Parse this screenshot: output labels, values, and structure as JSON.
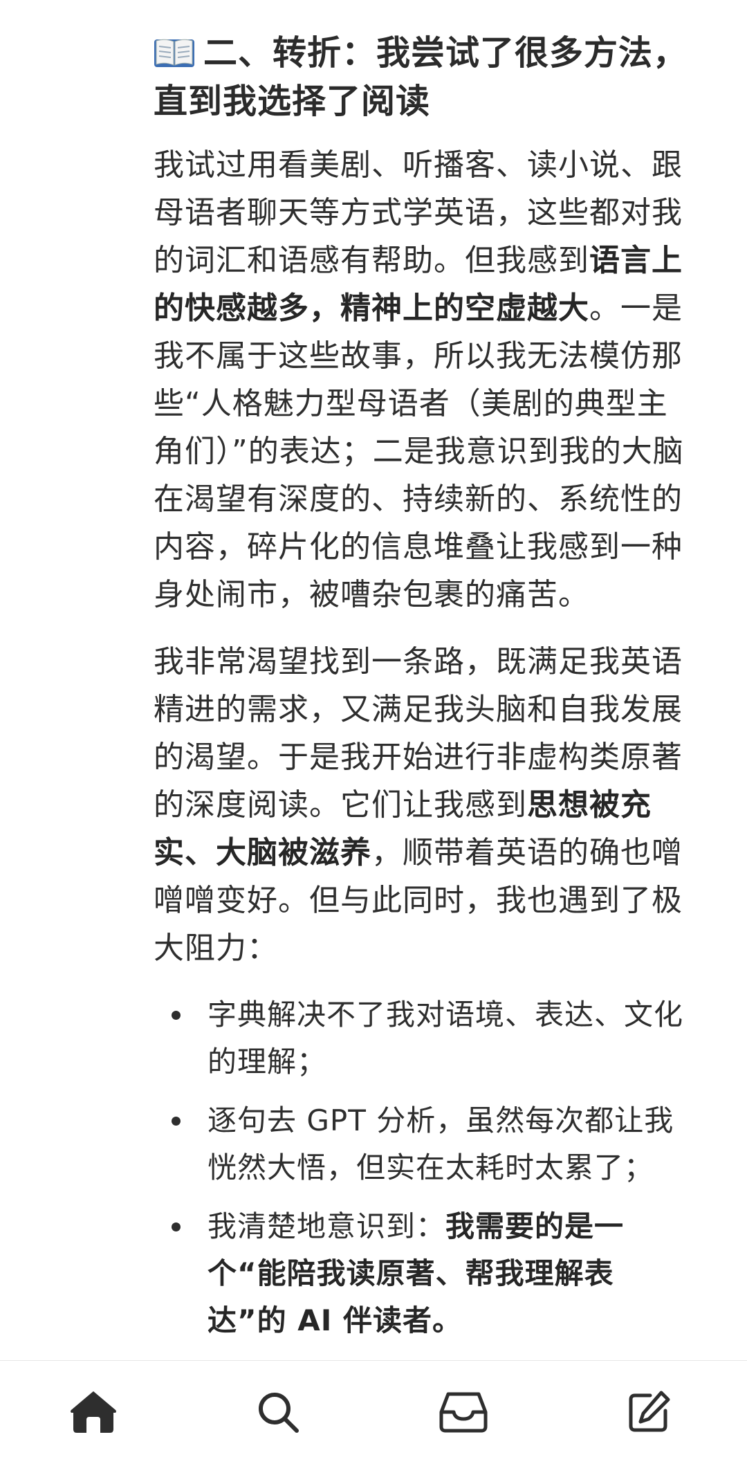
{
  "section": {
    "icon": "open-book-icon",
    "title": "二、转折：我尝试了很多方法，直到我选择了阅读"
  },
  "paragraph1": {
    "text_a": "我试过用看美剧、听播客、读小说、跟母语者聊天等方式学英语，这些都对我的词汇和语感有帮助。但我感到",
    "bold_a": "语言上的快感越多，精神上的空虚越大",
    "text_b": "。一是我不属于这些故事，所以我无法模仿那些“人格魅力型母语者（美剧的典型主角们）”的表达；二是我意识到我的大脑在渴望有深度的、持续新的、系统性的内容，碎片化的信息堆叠让我感到一种身处闹市，被嘈杂包裹的痛苦。"
  },
  "paragraph2": {
    "text_a": "我非常渴望找到一条路，既满足我英语精进的需求，又满足我头脑和自我发展的渴望。于是我开始进行非虚构类原著的深度阅读。它们让我感到",
    "bold_a": "思想被充实、大脑被滋养",
    "text_b": "，顺带着英语的确也噌噌噌变好。但与此同时，我也遇到了极大阻力："
  },
  "bullets": [
    {
      "text": "字典解决不了我对语境、表达、文化的理解；",
      "bold": ""
    },
    {
      "text": "逐句去 GPT 分析，虽然每次都让我恍然大悟，但实在太耗时太累了；",
      "bold": ""
    },
    {
      "text": "我清楚地意识到：",
      "bold": "我需要的是一个“能陪我读原著、帮我理解表达”的 AI 伴读者。"
    }
  ],
  "tabbar": {
    "items": [
      {
        "icon": "home-icon"
      },
      {
        "icon": "search-icon"
      },
      {
        "icon": "inbox-icon"
      },
      {
        "icon": "compose-icon"
      }
    ],
    "active_color": "#2e2e2e"
  }
}
